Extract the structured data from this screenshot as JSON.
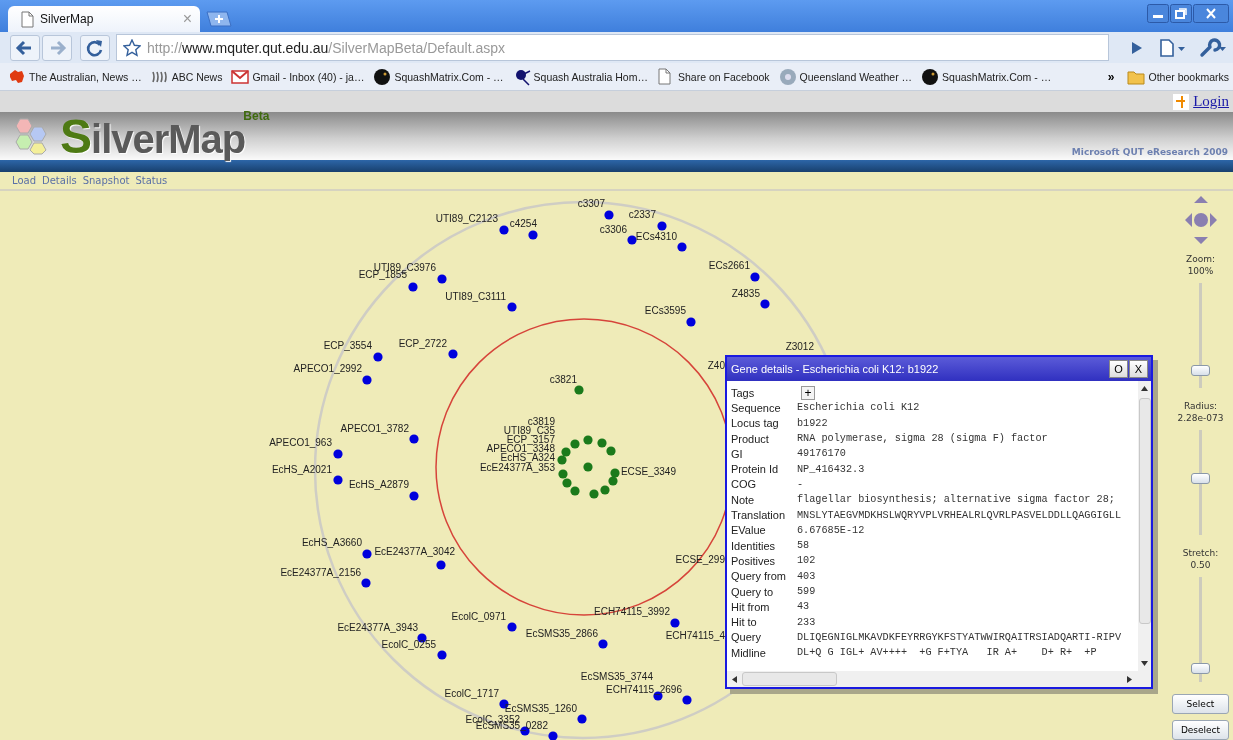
{
  "browser": {
    "tabs": [
      {
        "title": "SilverMap",
        "close": "×",
        "selected": true
      }
    ],
    "url": {
      "scheme": "http://",
      "host": "www.mquter.qut.edu.au",
      "path": "/SilverMapBeta/Default.aspx"
    },
    "bookmarks": [
      "The Australian, News …",
      "ABC News",
      "Gmail - Inbox (40) - ja…",
      "SquashMatrix.Com - …",
      "Squash Australia Hom…",
      "Share on Facebook",
      "Queensland Weather …",
      "SquashMatrix.Com - …"
    ],
    "more": "»",
    "other_bookmarks": "Other bookmarks"
  },
  "header": {
    "login": "Login",
    "logo": "SilverMap",
    "logo_badge": "Beta",
    "credit": "Microsoft QUT eResearch 2009"
  },
  "menu": [
    "Load",
    "Details",
    "Snapshot",
    "Status"
  ],
  "map": {
    "nodes": [
      {
        "label": "c3307",
        "color": "#0000dd"
      },
      {
        "label": "UTI89_C2123",
        "color": "#0000dd"
      },
      {
        "label": "c4254",
        "color": "#0000dd"
      },
      {
        "label": "c2337",
        "color": "#0000dd"
      },
      {
        "label": "c3306",
        "color": "#0000dd"
      },
      {
        "label": "ECs4310",
        "color": "#0000dd"
      },
      {
        "label": "ECs2661",
        "color": "#0000dd"
      },
      {
        "label": "UTI89_C3976",
        "color": "#0000dd"
      },
      {
        "label": "ECP_1855",
        "color": "#0000dd"
      },
      {
        "label": "Z4835",
        "color": "#0000dd"
      },
      {
        "label": "UTI89_C3111",
        "color": "#0000dd"
      },
      {
        "label": "ECs3595",
        "color": "#0000dd"
      },
      {
        "label": "ECP_2722",
        "color": "#0000dd"
      },
      {
        "label": "ECP_3554",
        "color": "#0000dd"
      },
      {
        "label": "APECO1_2992",
        "color": "#0000dd"
      },
      {
        "label": "c3821",
        "color": "#1b7a1b"
      },
      {
        "label": "c3819",
        "color": "#1b7a1b"
      },
      {
        "label": "UTI89_C35",
        "color": "#1b7a1b"
      },
      {
        "label": "ECP_3157",
        "color": "#1b7a1b"
      },
      {
        "label": "APECO1_3348",
        "color": "#1b7a1b"
      },
      {
        "label": "EcHS_A324",
        "color": "#1b7a1b"
      },
      {
        "label": "ECSE_3349",
        "color": "#1b7a1b"
      },
      {
        "label": "EcE24377A_353",
        "color": "#1b7a1b"
      },
      {
        "color": "#1b7a1b"
      },
      {
        "color": "#1b7a1b"
      },
      {
        "color": "#1b7a1b"
      },
      {
        "color": "#1b7a1b"
      },
      {
        "color": "#1b7a1b"
      },
      {
        "color": "#1b7a1b"
      },
      {
        "color": "#1b7a1b"
      },
      {
        "label": "APECO1_3782",
        "color": "#0000dd"
      },
      {
        "label": "APECO1_963",
        "color": "#0000dd"
      },
      {
        "label": "EcHS_A2021",
        "color": "#0000dd"
      },
      {
        "label": "EcHS_A2879",
        "color": "#0000dd"
      },
      {
        "label": "EcHS_A3660",
        "color": "#0000dd"
      },
      {
        "label": "EcE24377A_3042",
        "color": "#0000dd"
      },
      {
        "label": "EcE24377A_2156",
        "color": "#0000dd"
      },
      {
        "label": "ECH74115_3992",
        "color": "#0000dd"
      },
      {
        "label": "EcolC_0971",
        "color": "#0000dd"
      },
      {
        "label": "EcE24377A_3943",
        "color": "#0000dd"
      },
      {
        "label": "EcSMS35_2866",
        "color": "#0000dd"
      },
      {
        "label": "EcolC_0255",
        "color": "#0000dd"
      },
      {
        "label": "EcSMS35_3744",
        "color": "#0000dd"
      },
      {
        "label": "ECH74115_2696",
        "color": "#0000dd"
      },
      {
        "label": "EcolC_1717",
        "color": "#0000dd"
      },
      {
        "label": "EcSMS35_1260",
        "color": "#0000dd"
      },
      {
        "label": "EcolC_3352",
        "color": "#0000dd"
      },
      {
        "label": "EcSMS35_0282",
        "color": "#0000dd"
      }
    ],
    "cut_labels": [
      "Z3012",
      "Z40",
      "ECSE_299",
      "ECH74115_4"
    ]
  },
  "controls": {
    "sliders": [
      {
        "label": "Zoom:",
        "reading": "100%",
        "level": 0.12
      },
      {
        "label": "Radius:",
        "reading": "2.28e-073",
        "level": 0.52
      },
      {
        "label": "Stretch:",
        "reading": "0.50",
        "level": 0.08
      }
    ],
    "buttons": [
      "Select",
      "Deselect"
    ]
  },
  "dialog": {
    "title": "Gene details - Escherichia coli K12: b1922",
    "buttons": [
      "O",
      "X"
    ],
    "tags_label": "Tags",
    "tags_button": "+",
    "rows": [
      {
        "label": "Sequence",
        "value": "Escherichia coli K12"
      },
      {
        "label": "Locus tag",
        "value": "b1922"
      },
      {
        "label": "Product",
        "value": "RNA polymerase, sigma 28 (sigma F) factor"
      },
      {
        "label": "GI",
        "value": "49176170"
      },
      {
        "label": "Protein Id",
        "value": "NP_416432.3"
      },
      {
        "label": "COG",
        "value": "-"
      },
      {
        "label": "Note",
        "value": "flagellar biosynthesis; alternative sigma factor 28;"
      },
      {
        "label": "Translation",
        "value": "MNSLYTAEGVMDKHSLWQRYVPLVRHEALRLQVRLPASVELDDLLQAGGIGLL"
      },
      {
        "label": "EValue",
        "value": "6.67685E-12"
      },
      {
        "label": "Identities",
        "value": "58"
      },
      {
        "label": "Positives",
        "value": "102"
      },
      {
        "label": "Query from",
        "value": "403"
      },
      {
        "label": "Query to",
        "value": "599"
      },
      {
        "label": "Hit from",
        "value": "43"
      },
      {
        "label": "Hit to",
        "value": "233"
      },
      {
        "label": "Query",
        "value": "DLIQEGNIGLMKAVDKFEYRRGYKFSTYATWWIRQAITRSIADQARTI-RIPV"
      },
      {
        "label": "Midline",
        "value": "DL+Q G IGL+ AV++++  +G F+TYA   IR A+    D+ R+  +P"
      }
    ]
  }
}
